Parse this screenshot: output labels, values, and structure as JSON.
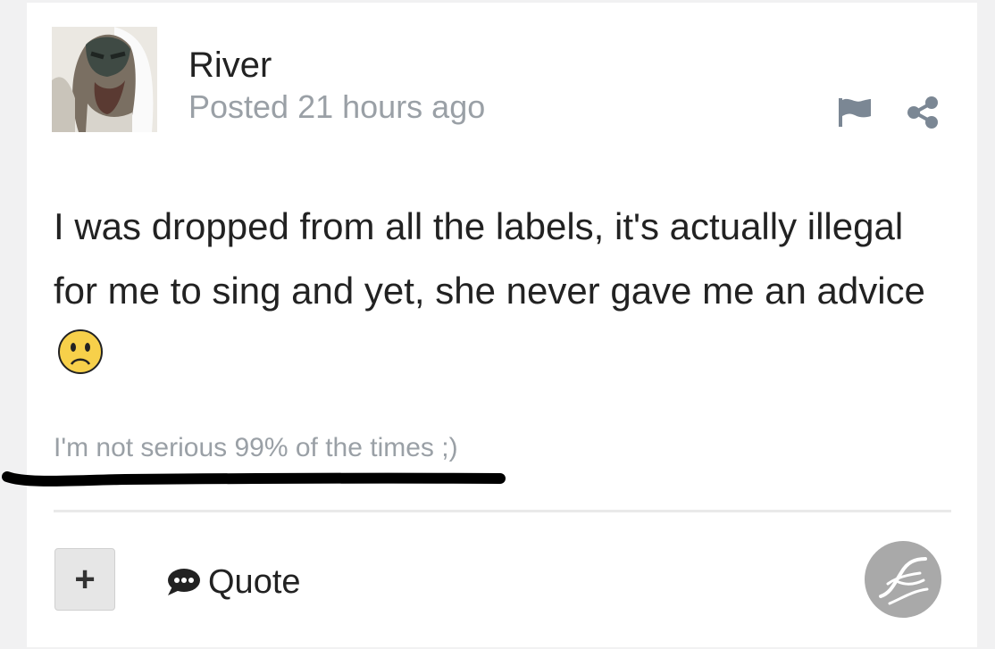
{
  "post": {
    "author": "River",
    "posted": "Posted 21 hours ago",
    "body": "I was dropped from all the labels, it's actually illegal for me to sing and yet, she never gave me an advice",
    "signature": "I'm not serious 99% of the times ;)"
  },
  "actions": {
    "plus_label": "+",
    "quote_label": "Quote"
  },
  "icons": {
    "flag": "flag-icon",
    "share": "share-icon",
    "quote": "speech-bubble-icon",
    "emoji": "frowning-face-emoji",
    "brand": "brand-logo"
  },
  "colors": {
    "text": "#222222",
    "muted": "#9aa0a6",
    "logo": "#a9a9a9"
  }
}
